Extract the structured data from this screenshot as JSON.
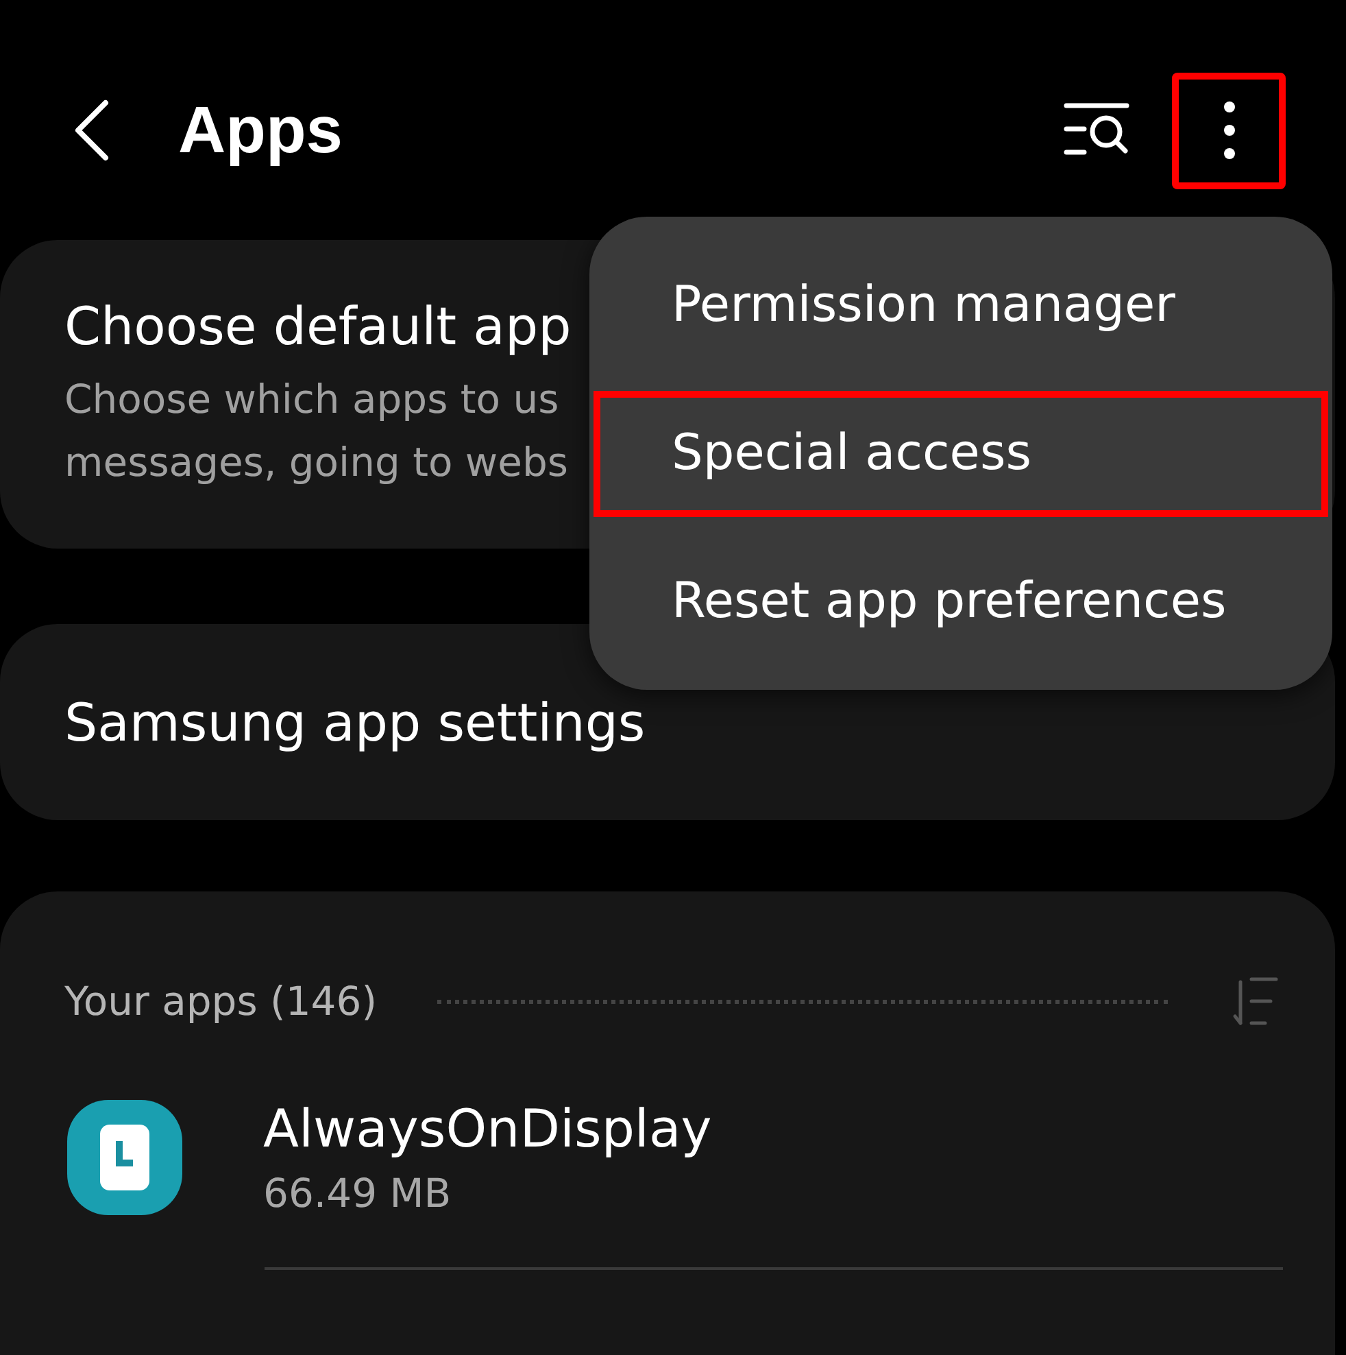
{
  "header": {
    "title": "Apps",
    "more_button": {
      "annotated": true
    }
  },
  "cards": [
    {
      "title": "Choose default app",
      "description_lines": [
        "Choose which apps to us",
        "messages, going to webs"
      ]
    },
    {
      "title": "Samsung app settings"
    }
  ],
  "apps_section": {
    "heading": "Your apps (146)",
    "apps": [
      {
        "name": "AlwaysOnDisplay",
        "size": "66.49 MB"
      }
    ]
  },
  "menu": {
    "items": [
      {
        "label": "Permission manager",
        "annotated": false
      },
      {
        "label": "Special access",
        "annotated": true
      },
      {
        "label": "Reset app preferences",
        "annotated": false
      }
    ]
  }
}
